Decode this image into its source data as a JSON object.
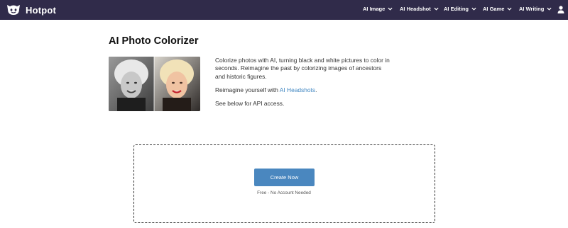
{
  "header": {
    "brand": "Hotpot",
    "nav": [
      {
        "label": "AI Image",
        "icon": "chevron-down-icon"
      },
      {
        "label": "AI Headshot",
        "icon": "chevron-down-icon"
      },
      {
        "label": "AI Editing",
        "icon": "chevron-down-icon"
      },
      {
        "label": "AI Game",
        "icon": "chevron-down-icon"
      },
      {
        "label": "AI Writing",
        "icon": "chevron-down-icon"
      }
    ],
    "user_icon": "user-icon",
    "colors": {
      "background": "#302b4a",
      "text": "#ffffff"
    }
  },
  "main": {
    "title": "AI Photo Colorizer",
    "description_1": "Colorize photos with AI, turning black and white pictures to color in seconds. Reimagine the past by colorizing images of ancestors and historic figures.",
    "description_2_prefix": "Reimagine yourself with ",
    "description_2_link": "AI Headshots",
    "description_2_suffix": ".",
    "description_3": "See below for API access.",
    "link_color": "#3f86c1"
  },
  "upload": {
    "button_label": "Create Now",
    "button_color": "#4a87bf",
    "subtext": "Free - No Account Needed"
  }
}
